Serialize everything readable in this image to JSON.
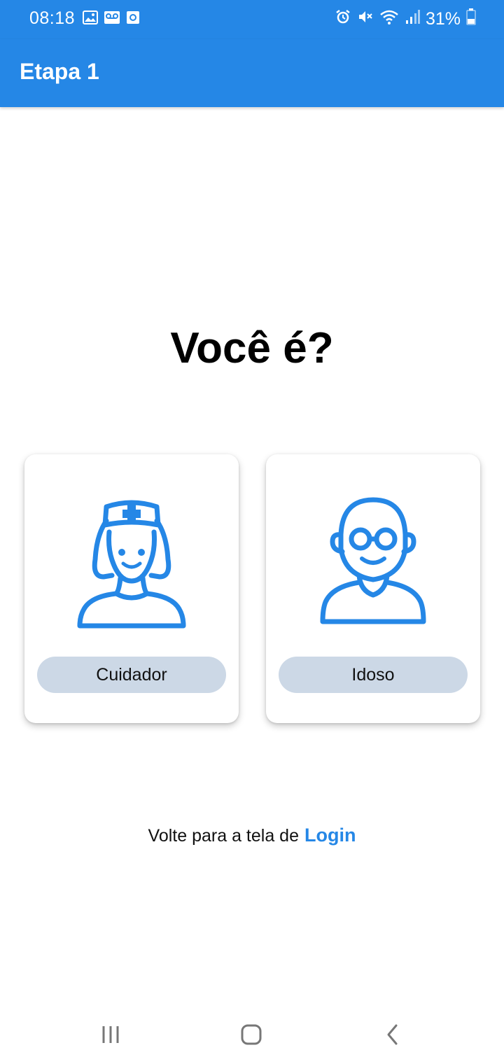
{
  "status_bar": {
    "time": "08:18",
    "battery": "31%",
    "left_icons": [
      "image-icon",
      "voicemail-icon",
      "screen-record-icon"
    ],
    "right_icons": [
      "alarm-icon",
      "mute-icon",
      "wifi-icon",
      "signal-icon",
      "battery-icon"
    ]
  },
  "app_bar": {
    "title": "Etapa 1",
    "color": "#2587e6"
  },
  "main": {
    "question": "Você é?",
    "options": [
      {
        "label": "Cuidador",
        "icon": "nurse-icon"
      },
      {
        "label": "Idoso",
        "icon": "elderly-man-icon"
      }
    ],
    "button_color": "#ccd8e6",
    "icon_color": "#2587e6"
  },
  "footer": {
    "prompt": "Volte para a tela de",
    "link": "Login"
  },
  "nav_bar": {
    "icons": [
      "recent-apps-icon",
      "home-icon",
      "back-icon"
    ]
  }
}
